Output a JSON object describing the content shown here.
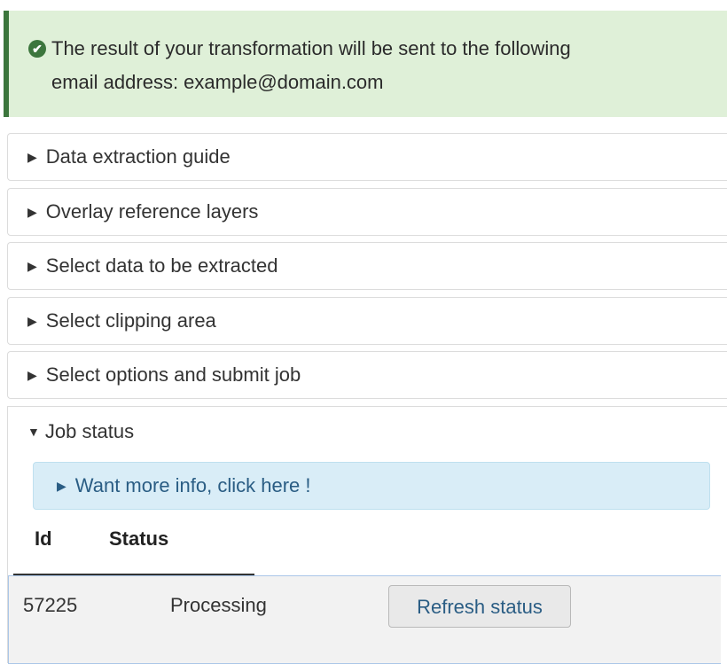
{
  "alert": {
    "icon": "check-circle-icon",
    "line1": "The result of your transformation will be sent to the following",
    "line2": "email address: example@domain.com"
  },
  "accordion": [
    {
      "label": "Data extraction guide",
      "state": "collapsed"
    },
    {
      "label": "Overlay reference layers",
      "state": "collapsed"
    },
    {
      "label": "Select data to be extracted",
      "state": "collapsed"
    },
    {
      "label": "Select clipping area",
      "state": "collapsed"
    },
    {
      "label": "Select options and submit job",
      "state": "collapsed"
    }
  ],
  "job_status": {
    "label": "Job status",
    "state": "expanded",
    "info_label": "Want more info, click here !",
    "table": {
      "headers": [
        "Id",
        "Status"
      ],
      "rows": [
        {
          "id": "57225",
          "status": "Processing",
          "action": "Refresh status"
        }
      ]
    }
  },
  "glyphs": {
    "collapsed": "▶",
    "expanded": "▼",
    "check": "✔"
  },
  "colors": {
    "success_bg": "#dff0d8",
    "success_accent": "#3c763d",
    "info_bg": "#d9edf7",
    "link": "#2a5d84"
  }
}
